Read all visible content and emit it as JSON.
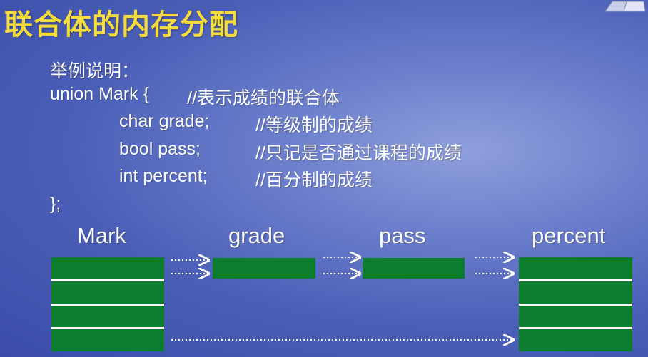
{
  "slide": {
    "title": "联合体的内存分配",
    "intro": "举例说明：",
    "code": {
      "line1": "union Mark {",
      "comment1": "//表示成绩的联合体",
      "member1": "char grade;",
      "comment2": "//等级制的成绩",
      "member2": "bool pass;",
      "comment3": "//只记是否通过课程的成绩",
      "member3": "int percent;",
      "comment4": "//百分制的成绩",
      "closing": "};"
    }
  },
  "diagram": {
    "labels": {
      "mark": "Mark",
      "grade": "grade",
      "pass": "pass",
      "percent": "percent"
    },
    "mark_segments": 4,
    "grade_segments": 1,
    "pass_segments": 1,
    "percent_segments": 4
  },
  "colors": {
    "title": "#f4dc3c",
    "block": "#0b7d2d",
    "text": "#ffffff"
  }
}
